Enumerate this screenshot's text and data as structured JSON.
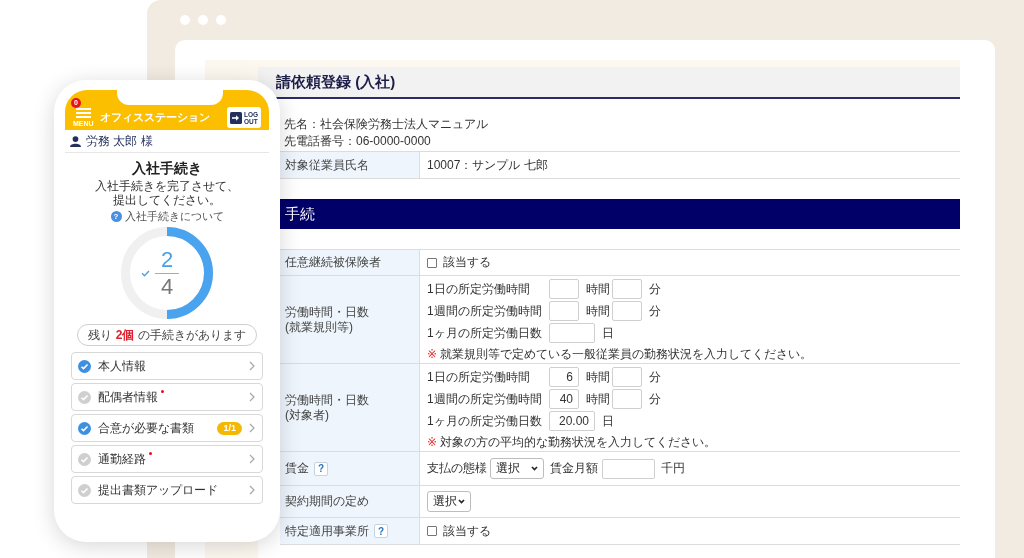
{
  "phone": {
    "menu_badge": "0",
    "menu_label": "MENU",
    "app_title": "オフィスステーション",
    "logout_label": "LOG OUT",
    "user": "労務 太郎 様",
    "title": "入社手続き",
    "subtitle": "入社手続きを完了させて、提出してください。",
    "help_link": {
      "icon": "?",
      "label": "入社手続きについて"
    },
    "progress": {
      "level": 0.5,
      "done": "2",
      "total": "4"
    },
    "remaining": "残り **2個** の手続きがあります",
    "steps": [
      {
        "label": "本人情報",
        "done": true,
        "required": false
      },
      {
        "label": "配偶者情報",
        "done": false,
        "required": true
      },
      {
        "label": "合意が必要な書類",
        "done": true,
        "required": false,
        "badge": "1/1"
      },
      {
        "label": "通勤経路",
        "done": false,
        "required": true
      },
      {
        "label": "提出書類アップロード",
        "done": false,
        "required": false
      }
    ]
  },
  "form": {
    "title": "請依頼登録 (入社)",
    "info_lines": [
      "先名：社会保険労務士法人マニュアル",
      "先電話番号：06-0000-0000"
    ],
    "employee": {
      "label": "対象従業員氏名",
      "value": "10007：サンプル 七郎"
    },
    "section_title": "手続",
    "rows": [
      {
        "kind": "checkbox",
        "label": "任意継続被保険者",
        "option": "該当する",
        "checked": false
      },
      {
        "kind": "hours",
        "label": "労働時間・日数",
        "sublabel": "(就業規則等)",
        "lines": [
          {
            "label": "1日の所定労働時間",
            "fields": [
              {
                "kind": "short",
                "unit": "時間"
              },
              {
                "kind": "short",
                "unit": "分"
              }
            ]
          },
          {
            "label": "1週間の所定労働時間",
            "fields": [
              {
                "kind": "short",
                "unit": "時間"
              },
              {
                "kind": "short",
                "unit": "分"
              }
            ]
          },
          {
            "label": "1ヶ月の所定労働日数",
            "fields": [
              {
                "kind": "long",
                "unit": "日"
              }
            ]
          }
        ],
        "note_mark": "※",
        "note": "就業規則等で定めている一般従業員の勤務状況を入力してください。"
      },
      {
        "kind": "hours",
        "label": "労働時間・日数",
        "sublabel": "(対象者)",
        "lines": [
          {
            "label": "1日の所定労働時間",
            "fields": [
              {
                "kind": "short",
                "value": "6",
                "unit": "時間"
              },
              {
                "kind": "short",
                "unit": "分"
              }
            ]
          },
          {
            "label": "1週間の所定労働時間",
            "fields": [
              {
                "kind": "short",
                "value": "40",
                "unit": "時間"
              },
              {
                "kind": "short",
                "unit": "分"
              }
            ]
          },
          {
            "label": "1ヶ月の所定労働日数",
            "fields": [
              {
                "kind": "long",
                "value": "20.00",
                "unit": "日"
              }
            ]
          }
        ],
        "note_mark": "※",
        "note": "対象の方の平均的な勤務状況を入力してください。"
      },
      {
        "kind": "wage",
        "label": "賃金",
        "help": "?",
        "pay_label": "支払の態様",
        "pay_select": "選択",
        "amount_label": "賃金月額",
        "amount_unit": "千円"
      },
      {
        "kind": "select",
        "label": "契約期間の定め",
        "select": "選択"
      },
      {
        "kind": "checkbox",
        "label": "特定適用事業所",
        "help": "?",
        "option": "該当する",
        "checked": false
      }
    ]
  }
}
